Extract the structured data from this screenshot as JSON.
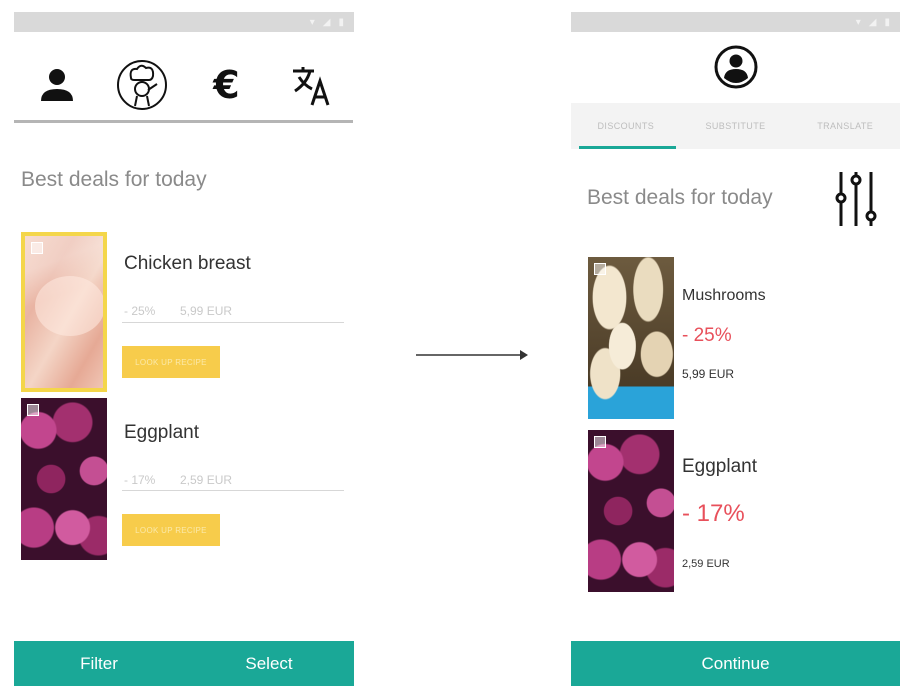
{
  "left": {
    "toolbar": {
      "icons": [
        "person-icon",
        "chef-icon",
        "euro-icon",
        "translate-icon"
      ],
      "euro_symbol": "€"
    },
    "title": "Best deals for today",
    "products": [
      {
        "name": "Chicken breast",
        "discount": "- 25%",
        "price": "5,99 EUR",
        "button": "LOOK UP RECIPE"
      },
      {
        "name": "Eggplant",
        "discount": "- 17%",
        "price": "2,59 EUR",
        "button": "LOOK UP RECIPE"
      }
    ],
    "bottom": {
      "filter": "Filter",
      "select": "Select"
    }
  },
  "right": {
    "tabs": [
      "DISCOUNTS",
      "SUBSTITUTE",
      "TRANSLATE"
    ],
    "active_tab": "DISCOUNTS",
    "title": "Best deals for today",
    "products": [
      {
        "name": "Mushrooms",
        "discount": "- 25%",
        "price": "5,99 EUR"
      },
      {
        "name": "Eggplant",
        "discount": "- 17%",
        "price": "2,59 EUR"
      }
    ],
    "bottom": {
      "continue": "Continue"
    }
  },
  "colors": {
    "accent": "#1aa897",
    "discount": "#e8505b",
    "recipe_button": "#f7cc4b",
    "status_bar": "#d9d9d9"
  }
}
